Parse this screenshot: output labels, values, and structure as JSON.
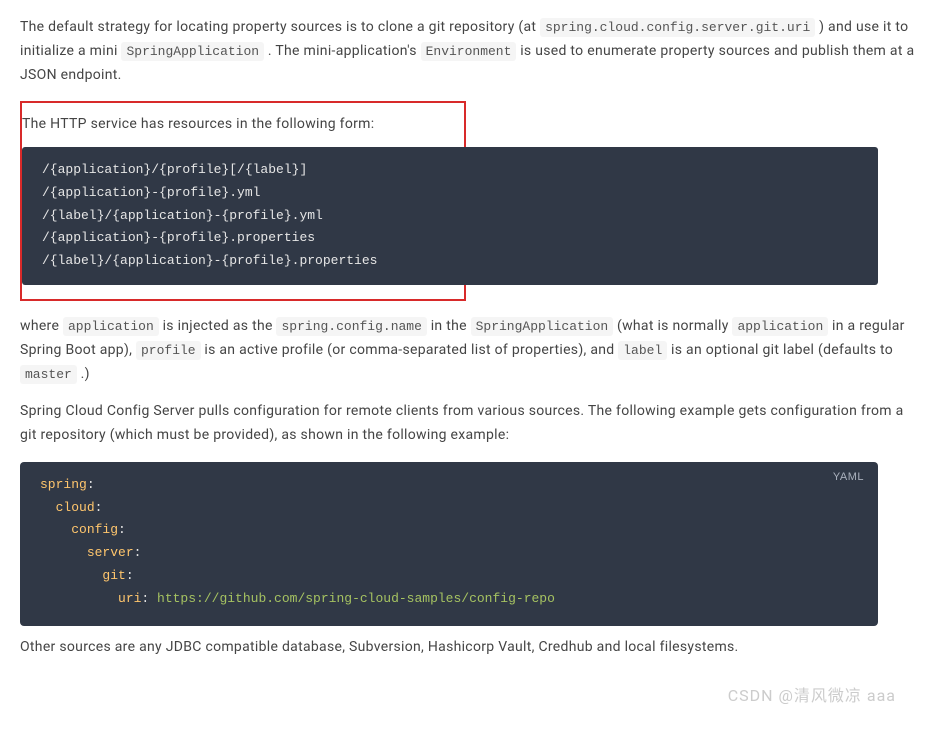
{
  "paragraphs": {
    "p1_a": "The default strategy for locating property sources is to clone a git repository (at ",
    "p1_code1": "spring.cloud.config.server.git.uri",
    "p1_b": " ) and use it to initialize a mini ",
    "p1_code2": "SpringApplication",
    "p1_c": " . The mini-application's ",
    "p1_code3": "Environment",
    "p1_d": " is used to enumerate property sources and publish them at a JSON endpoint.",
    "p2": "The HTTP service has resources in the following form:",
    "p3_a": "where ",
    "p3_code1": "application",
    "p3_b": " is injected as the ",
    "p3_code2": "spring.config.name",
    "p3_c": " in the ",
    "p3_code3": "SpringApplication",
    "p3_d": " (what is normally ",
    "p3_code4": "application",
    "p3_e": " in a regular Spring Boot app), ",
    "p3_code5": "profile",
    "p3_f": " is an active profile (or comma-separated list of properties), and ",
    "p3_code6": "label",
    "p3_g": " is an optional git label (defaults to ",
    "p3_code7": "master",
    "p3_h": " .)",
    "p4": "Spring Cloud Config Server pulls configuration for remote clients from various sources. The following example gets configuration from a git repository (which must be provided), as shown in the following example:",
    "p5": "Other sources are any JDBC compatible database, Subversion, Hashicorp Vault, Credhub and local filesystems."
  },
  "code_resources": "/{application}/{profile}[/{label}]\n/{application}-{profile}.yml\n/{label}/{application}-{profile}.yml\n/{application}-{profile}.properties\n/{label}/{application}-{profile}.properties",
  "yaml": {
    "label": "YAML",
    "k_spring": "spring",
    "k_cloud": "cloud",
    "k_config": "config",
    "k_server": "server",
    "k_git": "git",
    "k_uri": "uri",
    "v_uri": "https://github.com/spring-cloud-samples/config-repo"
  },
  "watermark": "CSDN @清风微凉 aaa"
}
